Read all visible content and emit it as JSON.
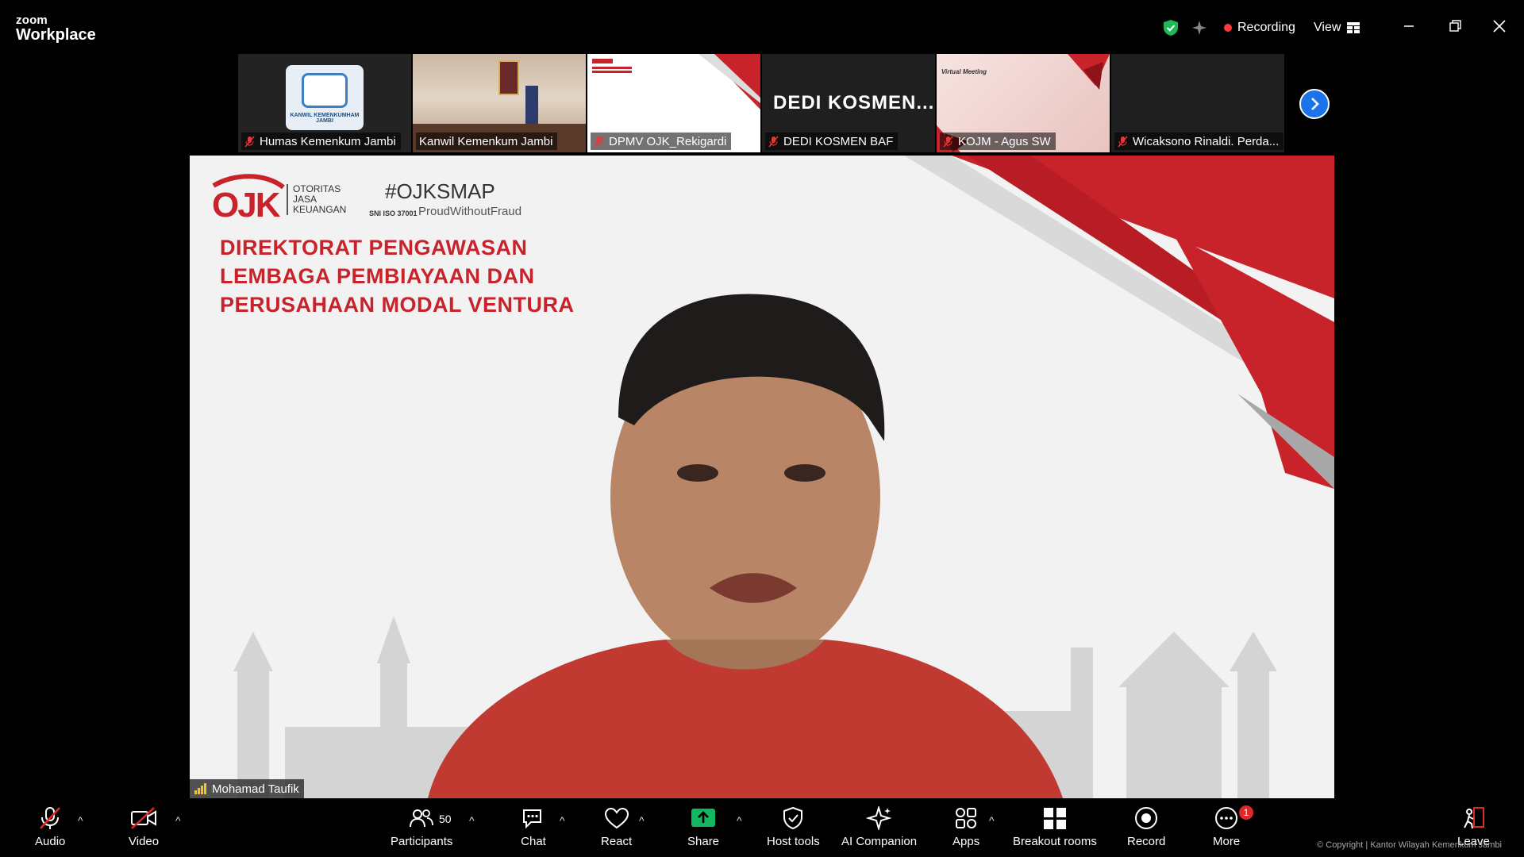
{
  "app": {
    "brand_top": "zoom",
    "brand_bottom": "Workplace"
  },
  "titlebar": {
    "recording_label": "Recording",
    "view_label": "View"
  },
  "thumbnails": [
    {
      "name": "Humas Kemenkum Jambi",
      "card_text": "KANWIL KEMENKUMHAM JAMBI"
    },
    {
      "name": "Kanwil Kemenkum Jambi"
    },
    {
      "name": "DPMV OJK_Rekigardi"
    },
    {
      "name": "DEDI KOSMEN BAF",
      "big_text": "DEDI  KOSMEN..."
    },
    {
      "name": "KOJM - Agus SW",
      "slide_text": "Virtual Meeting"
    },
    {
      "name": "Wicaksono Rinaldi.  Perda..."
    }
  ],
  "main": {
    "speaker_name": "Mohamad Taufik",
    "slide": {
      "logo_text": "OJK",
      "org_line1": "OTORITAS",
      "org_line2": "JASA",
      "org_line3": "KEUANGAN",
      "hashtag": "#OJKSMAP",
      "tagline": "ProudWithoutFraud",
      "iso": "SNI ISO 37001",
      "title_line1": "DIREKTORAT PENGAWASAN",
      "title_line2": "LEMBAGA PEMBIAYAAN DAN",
      "title_line3": "PERUSAHAAN MODAL VENTURA"
    }
  },
  "toolbar": {
    "audio": "Audio",
    "video": "Video",
    "participants": "Participants",
    "participants_count": "50",
    "chat": "Chat",
    "react": "React",
    "share": "Share",
    "host_tools": "Host tools",
    "ai_companion": "AI Companion",
    "apps": "Apps",
    "breakout_rooms": "Breakout rooms",
    "record": "Record",
    "more": "More",
    "more_badge": "1",
    "leave": "Leave"
  },
  "footer": {
    "copyright": "© Copyright | Kantor Wilayah Kemenkum Jambi"
  },
  "colors": {
    "ojk_red": "#c8222b",
    "share_green": "#12b760",
    "accent_blue": "#1a73e8",
    "recording_red": "#ff3b3b",
    "shield_green": "#1db954"
  }
}
